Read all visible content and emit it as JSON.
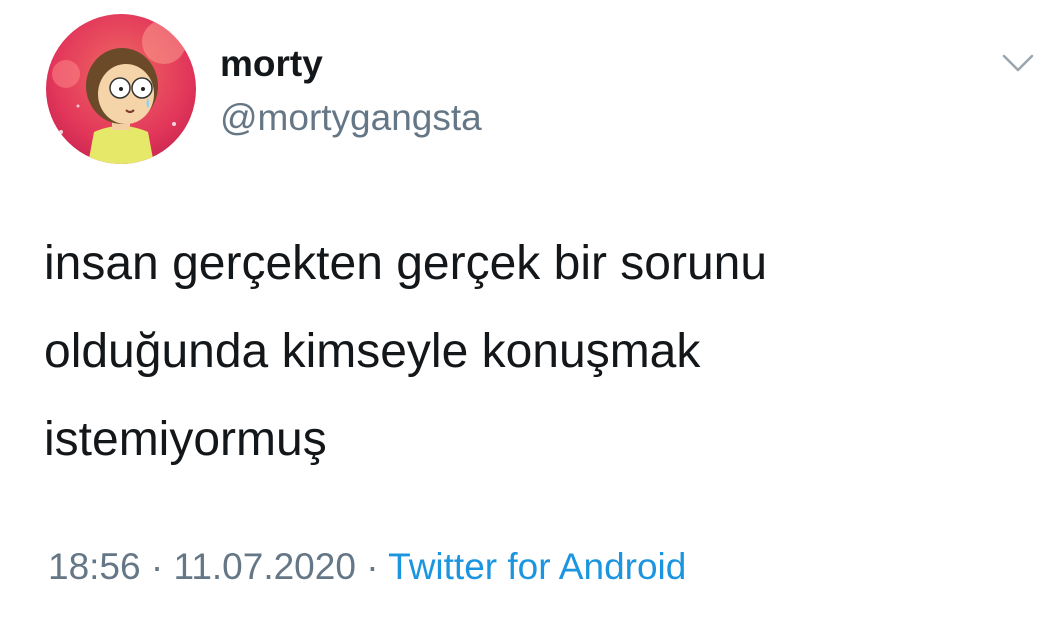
{
  "colors": {
    "text": "#14171a",
    "secondary": "#657786",
    "link": "#1b95e0"
  },
  "icons": {
    "avatar": "cartoon-character-avatar",
    "caret": "chevron-down-icon"
  },
  "user": {
    "display_name": "morty",
    "handle": "@mortygangsta"
  },
  "tweet": {
    "lines": [
      "insan gerçekten gerçek bir sorunu",
      "olduğunda kimseyle konuşmak",
      "istemiyormuş"
    ]
  },
  "meta": {
    "time": "18:56",
    "separator": "·",
    "date": "11.07.2020",
    "source": "Twitter for Android"
  }
}
